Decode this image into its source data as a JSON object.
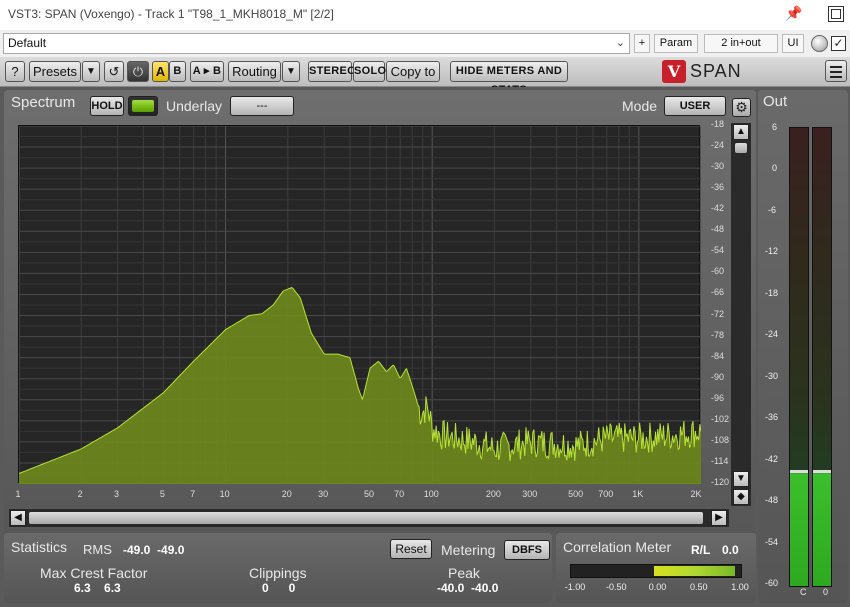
{
  "window": {
    "title": "VST3: SPAN (Voxengo) - Track 1 \"T98_1_MKH8018_M\" [2/2]"
  },
  "host": {
    "preset_value": "Default",
    "plus_label": "+",
    "param_label": "Param",
    "io_label": "2 in+out",
    "ui_label": "UI",
    "checkbox": "✓"
  },
  "toolbar": {
    "help_label": "?",
    "presets_label": "Presets",
    "a_label": "A",
    "b_label": "B",
    "ab_copy_label": "A ▸ B",
    "routing_label": "Routing",
    "stereo_label": "STEREO",
    "solo_label": "SOLO",
    "copyto_label": "Copy to",
    "hide_meters_label": "HIDE METERS AND STATS",
    "brand": "SPAN",
    "logo_letter": "V"
  },
  "spectrum": {
    "title": "Spectrum",
    "hold_label": "HOLD",
    "underlay_label": "Underlay",
    "underlay_value": "---",
    "mode_label": "Mode",
    "mode_value": "USER",
    "y_ticks": [
      "-18",
      "-24",
      "-30",
      "-36",
      "-42",
      "-48",
      "-54",
      "-60",
      "-66",
      "-72",
      "-78",
      "-84",
      "-90",
      "-96",
      "-102",
      "-108",
      "-114",
      "-120"
    ],
    "x_ticks": [
      {
        "label": "1",
        "f": 1
      },
      {
        "label": "2",
        "f": 2
      },
      {
        "label": "3",
        "f": 3
      },
      {
        "label": "5",
        "f": 5
      },
      {
        "label": "7",
        "f": 7
      },
      {
        "label": "10",
        "f": 10
      },
      {
        "label": "20",
        "f": 20
      },
      {
        "label": "30",
        "f": 30
      },
      {
        "label": "50",
        "f": 50
      },
      {
        "label": "70",
        "f": 70
      },
      {
        "label": "100",
        "f": 100
      },
      {
        "label": "200",
        "f": 200
      },
      {
        "label": "300",
        "f": 300
      },
      {
        "label": "500",
        "f": 500
      },
      {
        "label": "700",
        "f": 700
      },
      {
        "label": "1K",
        "f": 1000
      },
      {
        "label": "2K",
        "f": 2000
      }
    ],
    "fill_color": "#6f8a1c",
    "line_color": "#b7e236"
  },
  "statistics": {
    "title": "Statistics",
    "rms_label": "RMS",
    "rms_values": "-49.0  -49.0",
    "reset_label": "Reset",
    "metering_label": "Metering",
    "metering_value": "DBFS",
    "max_crest_label": "Max Crest Factor",
    "max_crest_values": "6.3    6.3",
    "clippings_label": "Clippings",
    "clippings_values": "0      0",
    "peak_label": "Peak",
    "peak_values": "-40.0  -40.0"
  },
  "correlation": {
    "title": "Correlation Meter",
    "rl_label": "R/L",
    "rl_value": "0.0",
    "ticks": [
      "-1.00",
      "-0.50",
      "0.00",
      "0.50",
      "1.00"
    ],
    "value": 0.0
  },
  "out": {
    "title": "Out",
    "ticks": [
      "6",
      "0",
      "-6",
      "-12",
      "-18",
      "-24",
      "-30",
      "-36",
      "-42",
      "-48",
      "-54",
      "-60"
    ],
    "channel_left": "C",
    "channel_right": "0",
    "level_db": -43.5
  }
}
